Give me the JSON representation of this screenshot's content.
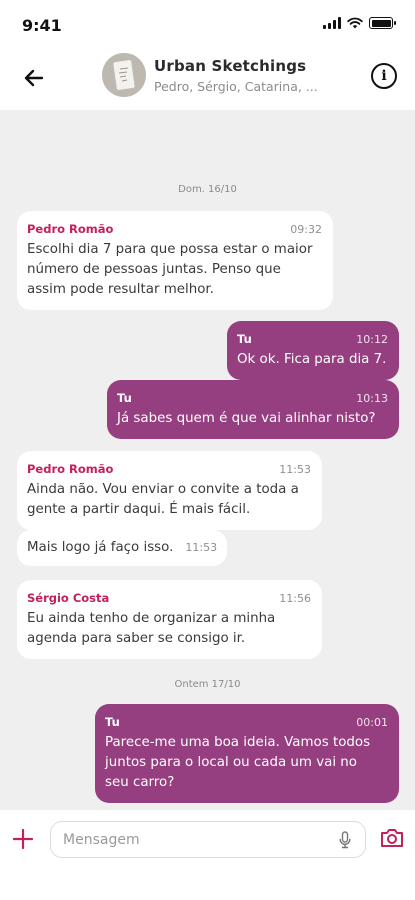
{
  "status_bar": {
    "time": "9:41"
  },
  "header": {
    "group_name": "Urban Sketchings",
    "members": "Pedro, Sérgio, Catarina, ...",
    "back_icon": "arrow-left-icon",
    "info_icon": "info-icon"
  },
  "colors": {
    "accent": "#953f80",
    "sender_name": "#c2215d",
    "chat_bg": "#efefef"
  },
  "chat": {
    "date_1": "Dom. 16/10",
    "date_2": "Ontem 17/10",
    "messages": [
      {
        "direction": "in",
        "sender": "Pedro Romão",
        "time": "09:32",
        "text": "Escolhi dia 7 para que possa estar o maior\nnúmero de pessoas juntas. Penso que\nassim pode resultar melhor."
      },
      {
        "direction": "out",
        "sender": "Tu",
        "time": "10:12",
        "text": "Ok ok. Fica para dia 7."
      },
      {
        "direction": "out",
        "sender": "Tu",
        "time": "10:13",
        "text": "Já sabes quem é que vai alinhar nisto?"
      },
      {
        "direction": "in",
        "sender": "Pedro Romão",
        "time": "11:53",
        "text": "Ainda não. Vou enviar o convite a toda a\ngente a partir daqui. É mais fácil."
      },
      {
        "direction": "in",
        "sender": "",
        "time": "11:53",
        "text": "Mais logo já faço isso."
      },
      {
        "direction": "in",
        "sender": "Sérgio Costa",
        "time": "11:56",
        "text": "Eu ainda tenho de organizar a minha\nagenda para saber se consigo ir."
      },
      {
        "direction": "out",
        "sender": "Tu",
        "time": "00:01",
        "text": "Parece-me uma boa ideia. Vamos todos\njuntos para o local ou cada um vai no\nseu carro?"
      }
    ]
  },
  "composer": {
    "placeholder": "Mensagem",
    "add_icon": "plus-icon",
    "mic_icon": "microphone-icon",
    "camera_icon": "camera-icon"
  }
}
